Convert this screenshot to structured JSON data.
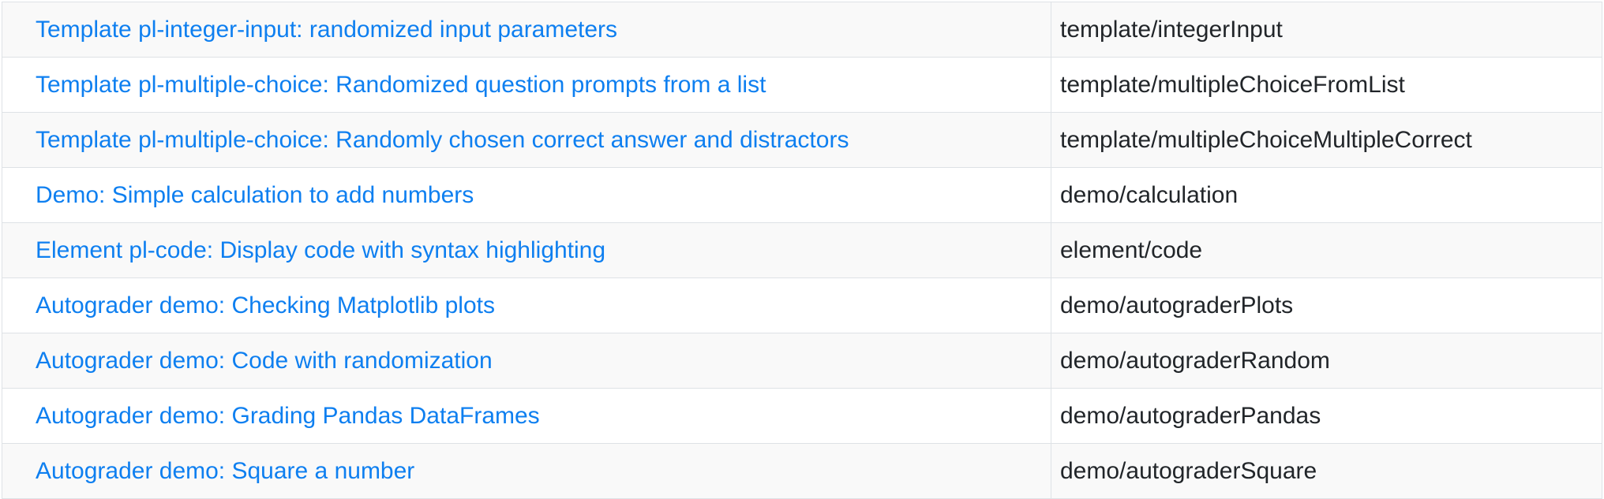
{
  "questions_table": {
    "rows": [
      {
        "title": "Template pl-integer-input: randomized input parameters",
        "qid": "template/integerInput"
      },
      {
        "title": "Template pl-multiple-choice: Randomized question prompts from a list",
        "qid": "template/multipleChoiceFromList"
      },
      {
        "title": "Template pl-multiple-choice: Randomly chosen correct answer and distractors",
        "qid": "template/multipleChoiceMultipleCorrect"
      },
      {
        "title": "Demo: Simple calculation to add numbers",
        "qid": "demo/calculation"
      },
      {
        "title": "Element pl-code: Display code with syntax highlighting",
        "qid": "element/code"
      },
      {
        "title": "Autograder demo: Checking Matplotlib plots",
        "qid": "demo/autograderPlots"
      },
      {
        "title": "Autograder demo: Code with randomization",
        "qid": "demo/autograderRandom"
      },
      {
        "title": "Autograder demo: Grading Pandas DataFrames",
        "qid": "demo/autograderPandas"
      },
      {
        "title": "Autograder demo: Square a number",
        "qid": "demo/autograderSquare"
      }
    ]
  }
}
